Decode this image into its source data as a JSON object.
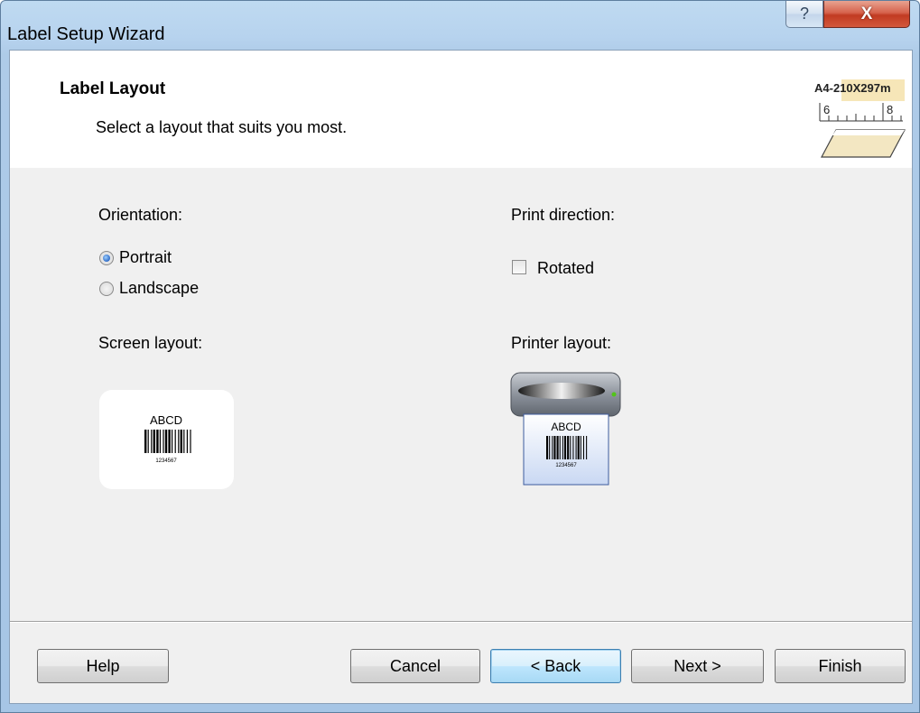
{
  "window": {
    "title": "Label Setup Wizard",
    "help_glyph": "?",
    "close_glyph": "X"
  },
  "header": {
    "title": "Label Layout",
    "subtitle": "Select a layout that suits you most.",
    "icon_caption": "A4-210X297m",
    "icon_ruler_left": "6",
    "icon_ruler_right": "8"
  },
  "orientation": {
    "label": "Orientation:",
    "options": [
      "Portrait",
      "Landscape"
    ],
    "selected": "Portrait"
  },
  "print_direction": {
    "label": "Print direction:",
    "rotated_label": "Rotated",
    "rotated_checked": false
  },
  "screen_layout": {
    "label": "Screen layout:",
    "preview_text": "ABCD",
    "preview_number": "1234567"
  },
  "printer_layout": {
    "label": "Printer layout:",
    "preview_text": "ABCD",
    "preview_number": "1234567"
  },
  "buttons": {
    "help": "Help",
    "cancel": "Cancel",
    "back": "< Back",
    "next": "Next >",
    "finish": "Finish"
  },
  "colors": {
    "accent": "#3c7fb1",
    "close": "#c13b22",
    "frame": "#aecbe8"
  },
  "icons": [
    "help-icon",
    "close-icon",
    "page-setup-icon",
    "printer-icon"
  ]
}
